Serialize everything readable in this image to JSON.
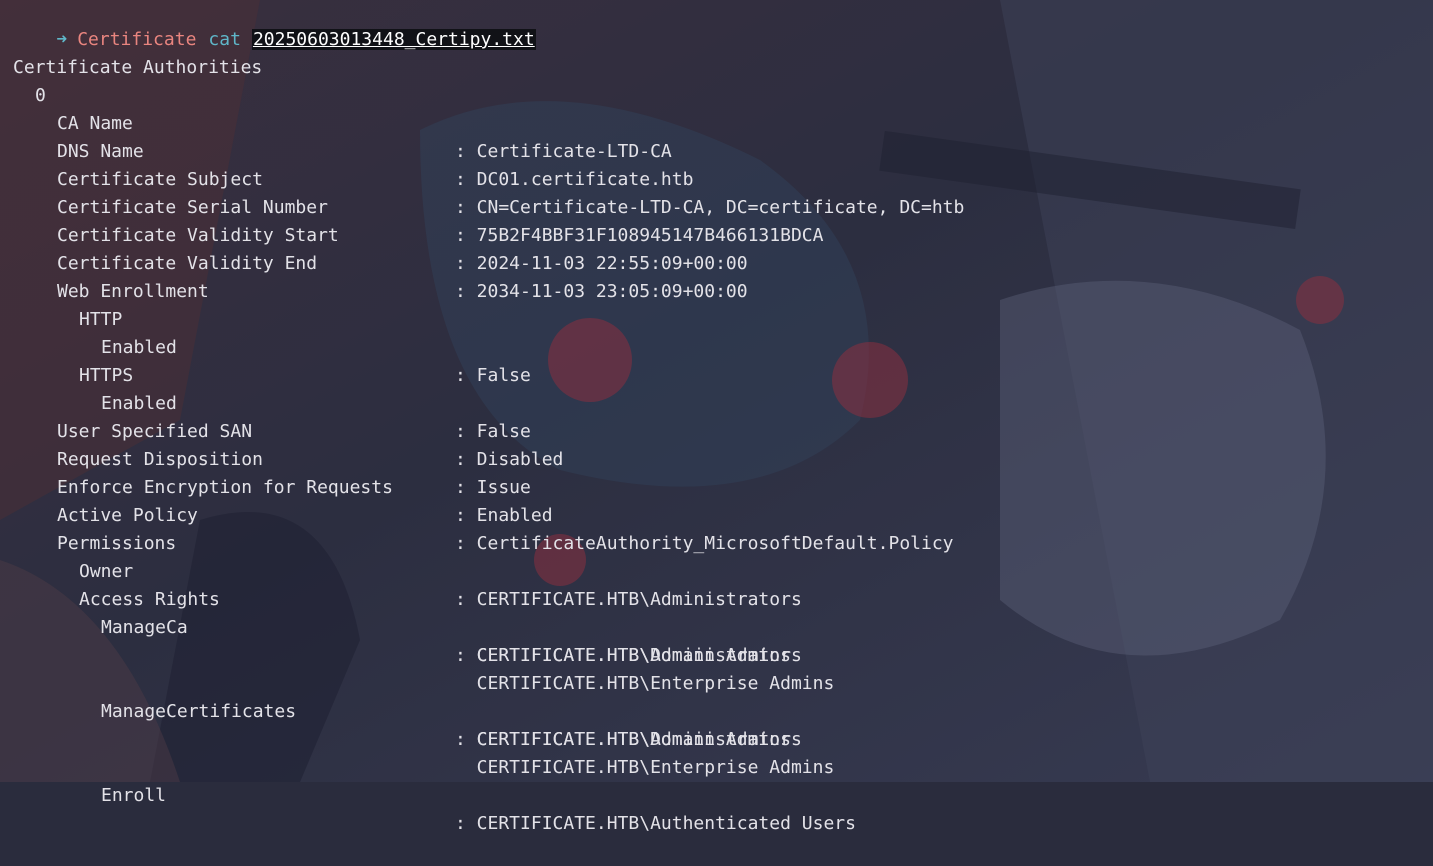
{
  "prompt": {
    "arrow": "➜",
    "directory": "Certificate",
    "command": "cat",
    "argument": "20250603013448_Certipy.txt"
  },
  "output": {
    "section_title": "Certificate Authorities",
    "ca_index": "0",
    "ca_name": {
      "label": "CA Name",
      "value": ": Certificate-LTD-CA"
    },
    "dns_name": {
      "label": "DNS Name",
      "value": ": DC01.certificate.htb"
    },
    "subject": {
      "label": "Certificate Subject",
      "value": ": CN=Certificate-LTD-CA, DC=certificate, DC=htb"
    },
    "serial": {
      "label": "Certificate Serial Number",
      "value": ": 75B2F4BBF31F108945147B466131BDCA"
    },
    "validity_start": {
      "label": "Certificate Validity Start",
      "value": ": 2024-11-03 22:55:09+00:00"
    },
    "validity_end": {
      "label": "Certificate Validity End",
      "value": ": 2034-11-03 23:05:09+00:00"
    },
    "web_enrollment": "Web Enrollment",
    "http": "HTTP",
    "http_enabled": {
      "label": "Enabled",
      "value": ": False"
    },
    "https": "HTTPS",
    "https_enabled": {
      "label": "Enabled",
      "value": ": False"
    },
    "user_san": {
      "label": "User Specified SAN",
      "value": ": Disabled"
    },
    "request_disposition": {
      "label": "Request Disposition",
      "value": ": Issue"
    },
    "enforce_encryption": {
      "label": "Enforce Encryption for Requests",
      "value": ": Enabled"
    },
    "active_policy": {
      "label": "Active Policy",
      "value": ": CertificateAuthority_MicrosoftDefault.Policy"
    },
    "permissions": "Permissions",
    "owner": {
      "label": "Owner",
      "value": ": CERTIFICATE.HTB\\Administrators"
    },
    "access_rights": "Access Rights",
    "manage_ca": {
      "label": "ManageCa",
      "values": [
        ": CERTIFICATE.HTB\\Administrators",
        "  CERTIFICATE.HTB\\Domain Admins",
        "  CERTIFICATE.HTB\\Enterprise Admins"
      ]
    },
    "manage_certificates": {
      "label": "ManageCertificates",
      "values": [
        ": CERTIFICATE.HTB\\Administrators",
        "  CERTIFICATE.HTB\\Domain Admins",
        "  CERTIFICATE.HTB\\Enterprise Admins"
      ]
    },
    "enroll": {
      "label": "Enroll",
      "value": ": CERTIFICATE.HTB\\Authenticated Users"
    }
  },
  "colors": {
    "background": "#2a2c3d",
    "text": "#e3e2e8",
    "prompt_arrow": "#5fb7c9",
    "prompt_dir": "#e9857f"
  }
}
